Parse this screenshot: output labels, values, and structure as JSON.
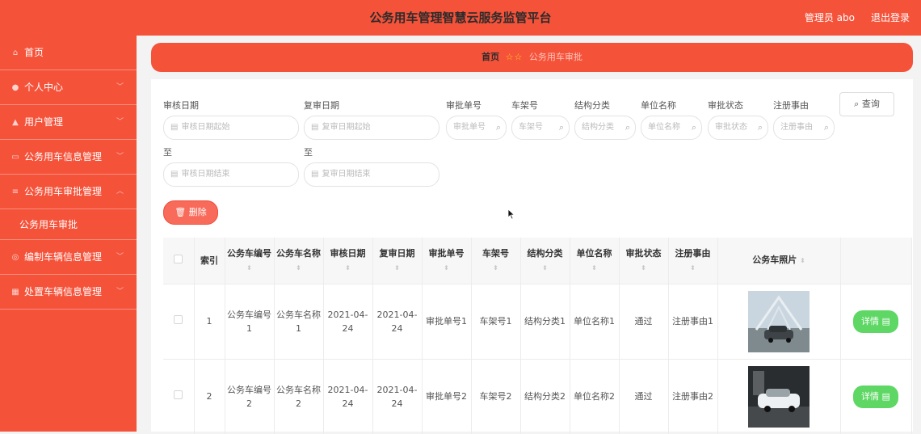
{
  "header": {
    "title": "公务用车管理智慧云服务监管平台",
    "user": "管理员 abo",
    "logout": "退出登录"
  },
  "sidebar": {
    "items": [
      {
        "label": "首页"
      },
      {
        "label": "个人中心"
      },
      {
        "label": "用户管理"
      },
      {
        "label": "公务用车信息管理"
      },
      {
        "label": "公务用车审批管理"
      },
      {
        "label": "编制车辆信息管理"
      },
      {
        "label": "处置车辆信息管理"
      }
    ],
    "sub_item": "公务用车审批"
  },
  "breadcrumb": {
    "home": "首页",
    "stars": "☆☆",
    "current": "公务用车审批"
  },
  "search": {
    "audit_date_label": "审核日期",
    "audit_date_start_ph": "审核日期起始",
    "to_label_1": "至",
    "audit_date_end_ph": "审核日期结束",
    "review_date_label": "复审日期",
    "review_date_start_ph": "复审日期起始",
    "to_label_2": "至",
    "review_date_end_ph": "复审日期结束",
    "approval_no_label": "审批单号",
    "approval_no_ph": "审批单号",
    "frame_no_label": "车架号",
    "frame_no_ph": "车架号",
    "structure_label": "结构分类",
    "structure_ph": "结构分类",
    "unit_label": "单位名称",
    "unit_ph": "单位名称",
    "status_label": "审批状态",
    "status_ph": "审批状态",
    "reason_label": "注册事由",
    "reason_ph": "注册事由",
    "query_button": "查询"
  },
  "actions": {
    "delete_button": "删除"
  },
  "table": {
    "headers": [
      "索引",
      "公务车编号",
      "公务车名称",
      "审核日期",
      "复审日期",
      "审批单号",
      "车架号",
      "结构分类",
      "单位名称",
      "审批状态",
      "注册事由",
      "公务车照片"
    ],
    "rows": [
      {
        "index": "1",
        "car_no": "公务车编号1",
        "car_name": "公务车名称1",
        "audit_date": "2021-04-24",
        "review_date": "2021-04-24",
        "approval_no": "审批单号1",
        "frame_no": "车架号1",
        "structure": "结构分类1",
        "unit": "单位名称1",
        "status": "通过",
        "reason": "注册事由1",
        "detail": "详情"
      },
      {
        "index": "2",
        "car_no": "公务车编号2",
        "car_name": "公务车名称2",
        "audit_date": "2021-04-24",
        "review_date": "2021-04-24",
        "approval_no": "审批单号2",
        "frame_no": "车架号2",
        "structure": "结构分类2",
        "unit": "单位名称2",
        "status": "通过",
        "reason": "注册事由2",
        "detail": "详情"
      }
    ]
  },
  "colors": {
    "accent": "#f5523a",
    "detail_button": "#5ed765",
    "delete_button": "#f86b5a"
  }
}
